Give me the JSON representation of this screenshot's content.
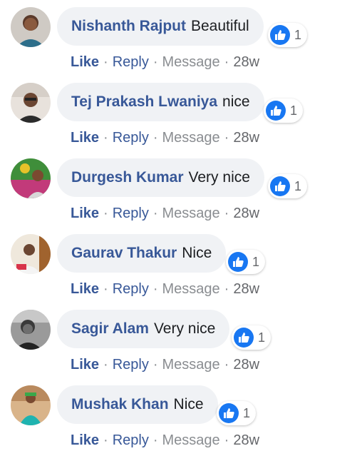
{
  "actions": {
    "like": "Like",
    "reply": "Reply",
    "message": "Message",
    "separator": "·"
  },
  "colors": {
    "name_blue": "#385898",
    "bubble_bg": "#f0f2f5",
    "like_blue": "#1877f2"
  },
  "comments": [
    {
      "name": "Nishanth Rajput",
      "text": "Beautiful",
      "reactions": "1",
      "time": "28w"
    },
    {
      "name": "Tej Prakash Lwaniya",
      "text": "nice",
      "reactions": "1",
      "time": "28w"
    },
    {
      "name": "Durgesh Kumar",
      "text": "Very nice",
      "reactions": "1",
      "time": "28w"
    },
    {
      "name": "Gaurav Thakur",
      "text": "Nice",
      "reactions": "1",
      "time": "28w"
    },
    {
      "name": "Sagir Alam",
      "text": "Very nice",
      "reactions": "1",
      "time": "28w"
    },
    {
      "name": "Mushak Khan",
      "text": "Nice",
      "reactions": "1",
      "time": "28w"
    }
  ]
}
